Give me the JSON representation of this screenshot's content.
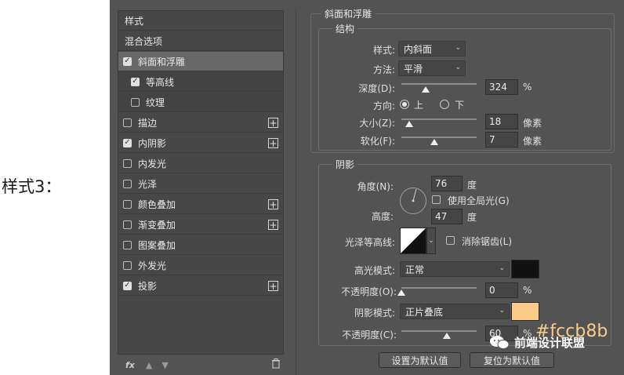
{
  "side_label": "样式3：",
  "styles_list": {
    "header": "样式",
    "blend_options": "混合选项",
    "items": [
      {
        "label": "斜面和浮雕",
        "checked": true,
        "selected": true,
        "sub": false,
        "plus": false
      },
      {
        "label": "等高线",
        "checked": true,
        "selected": false,
        "sub": true,
        "plus": false
      },
      {
        "label": "纹理",
        "checked": false,
        "selected": false,
        "sub": true,
        "plus": false
      },
      {
        "label": "描边",
        "checked": false,
        "selected": false,
        "sub": false,
        "plus": true
      },
      {
        "label": "内阴影",
        "checked": true,
        "selected": false,
        "sub": false,
        "plus": true
      },
      {
        "label": "内发光",
        "checked": false,
        "selected": false,
        "sub": false,
        "plus": false
      },
      {
        "label": "光泽",
        "checked": false,
        "selected": false,
        "sub": false,
        "plus": false
      },
      {
        "label": "颜色叠加",
        "checked": false,
        "selected": false,
        "sub": false,
        "plus": true
      },
      {
        "label": "渐变叠加",
        "checked": false,
        "selected": false,
        "sub": false,
        "plus": true
      },
      {
        "label": "图案叠加",
        "checked": false,
        "selected": false,
        "sub": false,
        "plus": false
      },
      {
        "label": "外发光",
        "checked": false,
        "selected": false,
        "sub": false,
        "plus": false
      },
      {
        "label": "投影",
        "checked": true,
        "selected": false,
        "sub": false,
        "plus": true
      }
    ],
    "footer": {
      "fx": "fx",
      "up": "▲",
      "down": "▼",
      "trash": "🗑"
    }
  },
  "bevel": {
    "title": "斜面和浮雕",
    "structure_title": "结构",
    "style_label": "样式:",
    "style_value": "内斜面",
    "method_label": "方法:",
    "method_value": "平滑",
    "depth_label": "深度(D):",
    "depth_value": "324",
    "depth_unit": "%",
    "depth_pct": 0.32,
    "direction_label": "方向:",
    "dir_up": "上",
    "dir_down": "下",
    "size_label": "大小(Z):",
    "size_value": "18",
    "size_unit": "像素",
    "size_pct": 0.1,
    "soften_label": "软化(F):",
    "soften_value": "7",
    "soften_unit": "像素",
    "soften_pct": 0.44
  },
  "shading": {
    "title": "阴影",
    "angle_label": "角度(N):",
    "angle_value": "76",
    "angle_unit": "度",
    "global_light": "使用全局光(G)",
    "altitude_label": "高度:",
    "altitude_value": "47",
    "altitude_unit": "度",
    "gloss_label": "光泽等高线:",
    "anti_alias": "消除锯齿(L)",
    "highlight_mode_label": "高光模式:",
    "highlight_mode_value": "正常",
    "highlight_color": "#111111",
    "opacity1_label": "不透明度(O):",
    "opacity1_value": "0",
    "opacity1_unit": "%",
    "opacity1_pct": 0,
    "shadow_mode_label": "阴影模式:",
    "shadow_mode_value": "正片叠底",
    "shadow_color": "#fccb8b",
    "opacity2_label": "不透明度(C):",
    "opacity2_value": "60",
    "opacity2_unit": "%",
    "opacity2_pct": 0.6
  },
  "buttons": {
    "set_default": "设置为默认值",
    "reset_default": "复位为默认值"
  },
  "watermark": {
    "text": "前端设计联盟",
    "hex": "#fccb8b"
  }
}
